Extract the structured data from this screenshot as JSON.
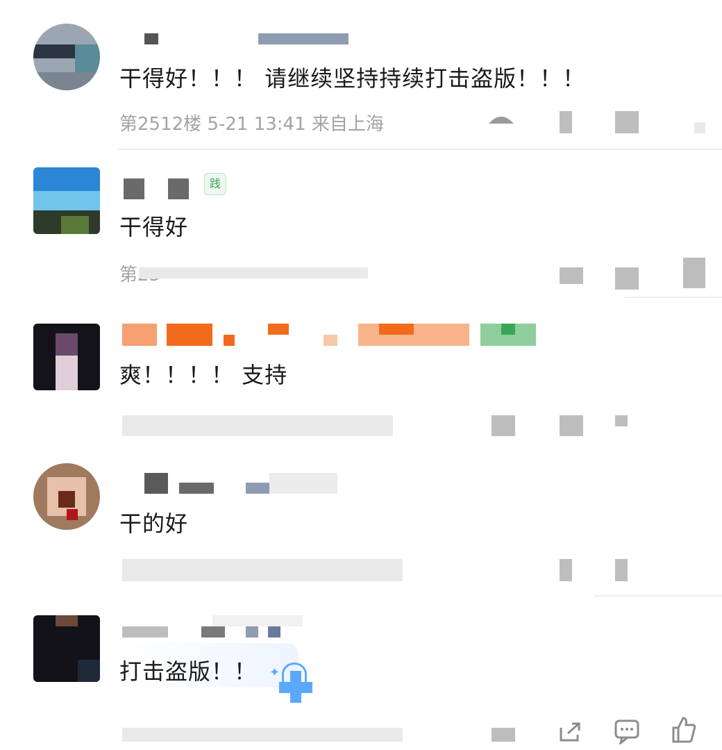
{
  "comments": [
    {
      "content": "干得好！！！ 请继续坚持持续打击盗版！！！",
      "floor": "第2512楼",
      "date": "5-21 13:41",
      "location": "来自上海"
    },
    {
      "content": "干得好",
      "floor_prefix": "第25"
    },
    {
      "content": "爽！！！！ 支持"
    },
    {
      "content": "干的好"
    },
    {
      "content": "打击盗版！！"
    }
  ],
  "badge_text": "践",
  "icons": [
    "share-icon",
    "comment-icon",
    "like-icon"
  ],
  "colors": {
    "text": "#1a1a1a",
    "meta": "#a3a3a3",
    "divider": "#eeeeee",
    "username_orange": "#f26b1d",
    "username_green": "#3aa55a",
    "sticker_blue": "#5aa9ff"
  }
}
